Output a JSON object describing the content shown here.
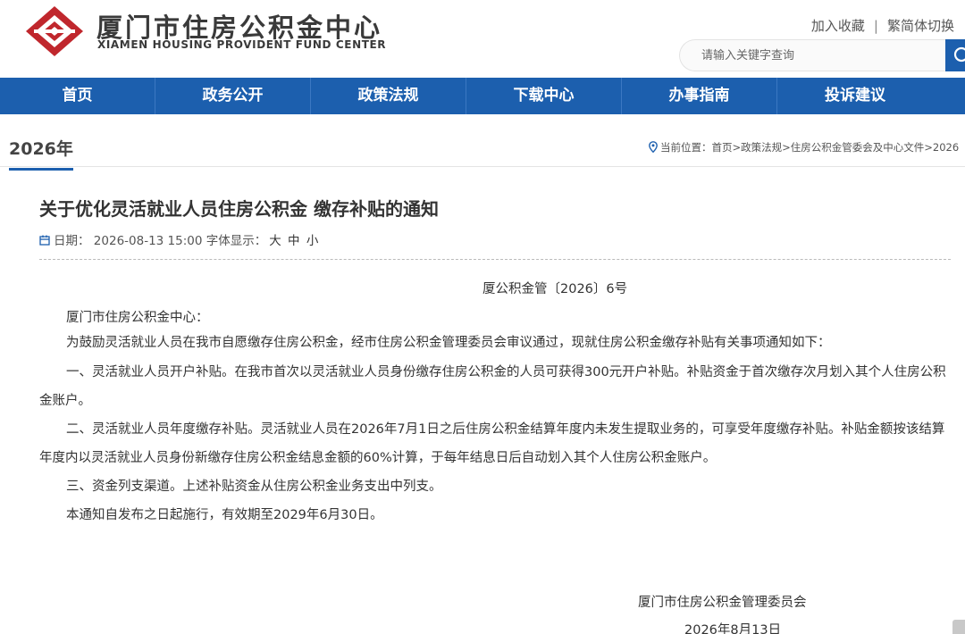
{
  "header": {
    "site_name_cn": "厦门市住房公积金中心",
    "site_name_en": "XIAMEN HOUSING PROVIDENT FUND CENTER",
    "add_favorite": "加入收藏",
    "separator": "|",
    "lang_toggle": "繁简体切换",
    "search_placeholder": "请输入关键字查询",
    "logo_color": "#c0272d"
  },
  "nav": {
    "accent": "#1c5fae",
    "items": [
      "首页",
      "政务公开",
      "政策法规",
      "下载中心",
      "办事指南",
      "投诉建议"
    ]
  },
  "subhead": {
    "year_tab": "2026年",
    "breadcrumb_prefix": "当前位置：",
    "crumbs": [
      "首页",
      "政策法规",
      "住房公积金管委会及中心文件",
      "2026"
    ]
  },
  "article": {
    "title": "关于优化灵活就业人员住房公积金 缴存补贴的通知",
    "date_label": "日期：",
    "date_value": "2026-08-13 15:00",
    "font_label": "字体显示：",
    "font_sizes": [
      "大",
      "中",
      "小"
    ],
    "doc_number": "厦公积金管〔2026〕6号",
    "paragraphs": [
      "厦门市住房公积金中心：",
      "为鼓励灵活就业人员在我市自愿缴存住房公积金，经市住房公积金管理委员会审议通过，现就住房公积金缴存补贴有关事项通知如下：",
      "一、灵活就业人员开户补贴。在我市首次以灵活就业人员身份缴存住房公积金的人员可获得300元开户补贴。补贴资金于首次缴存次月划入其个人住房公积金账户。",
      "二、灵活就业人员年度缴存补贴。灵活就业人员在2026年7月1日之后住房公积金结算年度内未发生提取业务的，可享受年度缴存补贴。补贴金额按该结算年度内以灵活就业人员身份新缴存住房公积金结息金额的60%计算，于每年结息日后自动划入其个人住房公积金账户。",
      "三、资金列支渠道。上述补贴资金从住房公积金业务支出中列支。",
      "本通知自发布之日起施行，有效期至2029年6月30日。"
    ],
    "signature_org": "厦门市住房公积金管理委员会",
    "signature_date": "2026年8月13日"
  }
}
